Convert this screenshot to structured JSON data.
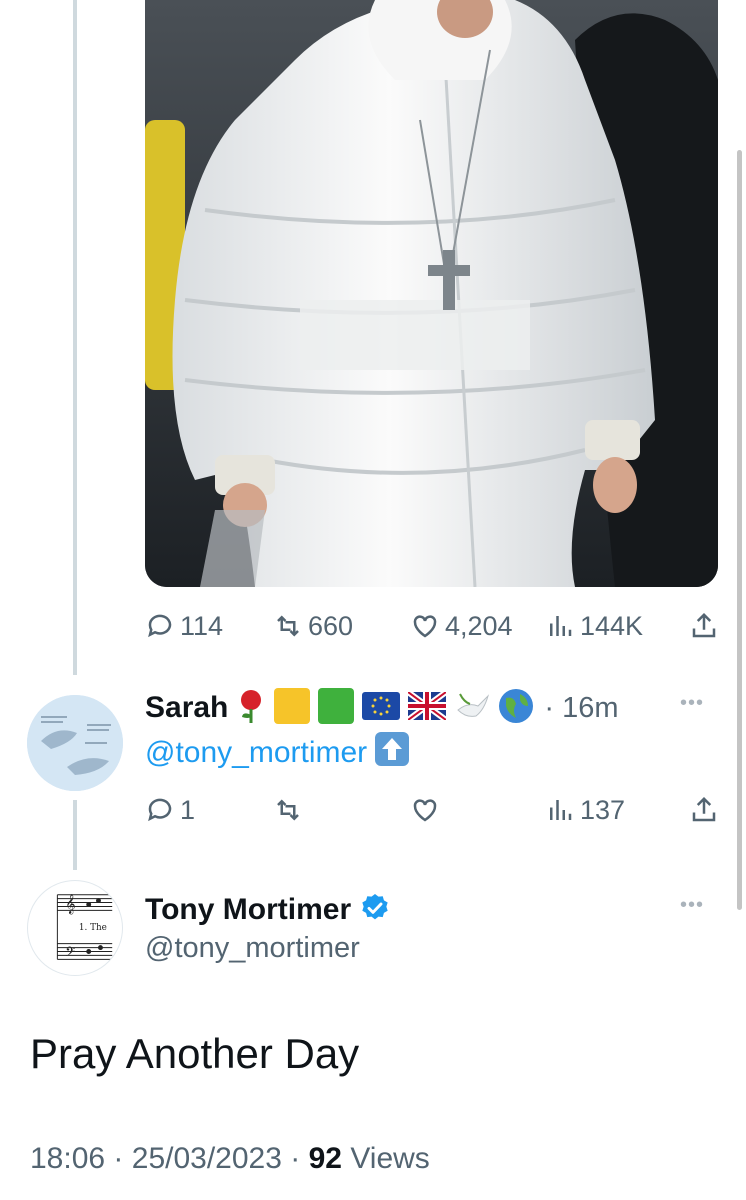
{
  "prev_tweet": {
    "media": {
      "description_icon": "puffer-coat-photo-icon"
    },
    "actions": {
      "replies": "114",
      "retweets": "660",
      "likes": "4,204",
      "views": "144K"
    }
  },
  "reply": {
    "display_name": "Sarah",
    "emojis": [
      "rose-emoji",
      "yellow-square-emoji",
      "green-square-emoji",
      "eu-flag-emoji",
      "uk-flag-emoji",
      "dove-emoji",
      "globe-emoji"
    ],
    "time": "· 16m",
    "more": "•••",
    "mention": "@tony_mortimer",
    "arrow_emoji": "up-arrow-emoji",
    "actions": {
      "replies": "1",
      "retweets": "",
      "likes": "",
      "views": "137"
    }
  },
  "main_tweet": {
    "display_name": "Tony Mortimer",
    "handle": "@tony_mortimer",
    "verified": true,
    "more": "•••",
    "text": "Pray Another Day",
    "time": "18:06",
    "date": "25/03/2023",
    "sep": "·",
    "views_count": "92",
    "views_label": "Views"
  },
  "colors": {
    "accent": "#1d9bf0",
    "secondary_text": "#536471",
    "primary_text": "#0f1419",
    "thread_line": "#cfd9de"
  }
}
